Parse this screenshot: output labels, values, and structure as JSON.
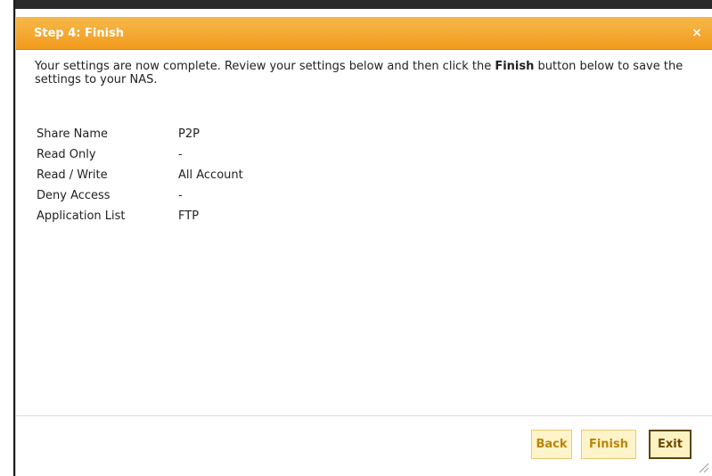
{
  "dialog": {
    "title": "Step 4: Finish",
    "close_glyph": "×",
    "intro_before": "Your settings are now complete. Review your settings below and then click the ",
    "intro_bold": "Finish",
    "intro_after": " button below to save the settings to your NAS."
  },
  "summary": [
    {
      "label": "Share Name",
      "value": "P2P"
    },
    {
      "label": "Read Only",
      "value": "-"
    },
    {
      "label": "Read / Write",
      "value": "All Account"
    },
    {
      "label": "Deny Access",
      "value": "-"
    },
    {
      "label": "Application List",
      "value": "FTP"
    }
  ],
  "buttons": {
    "back": "Back",
    "finish": "Finish",
    "exit": "Exit"
  },
  "colors": {
    "titlebar": "#f29a1d",
    "button_bg": "#fff3c9",
    "button_text": "#b8860b"
  }
}
